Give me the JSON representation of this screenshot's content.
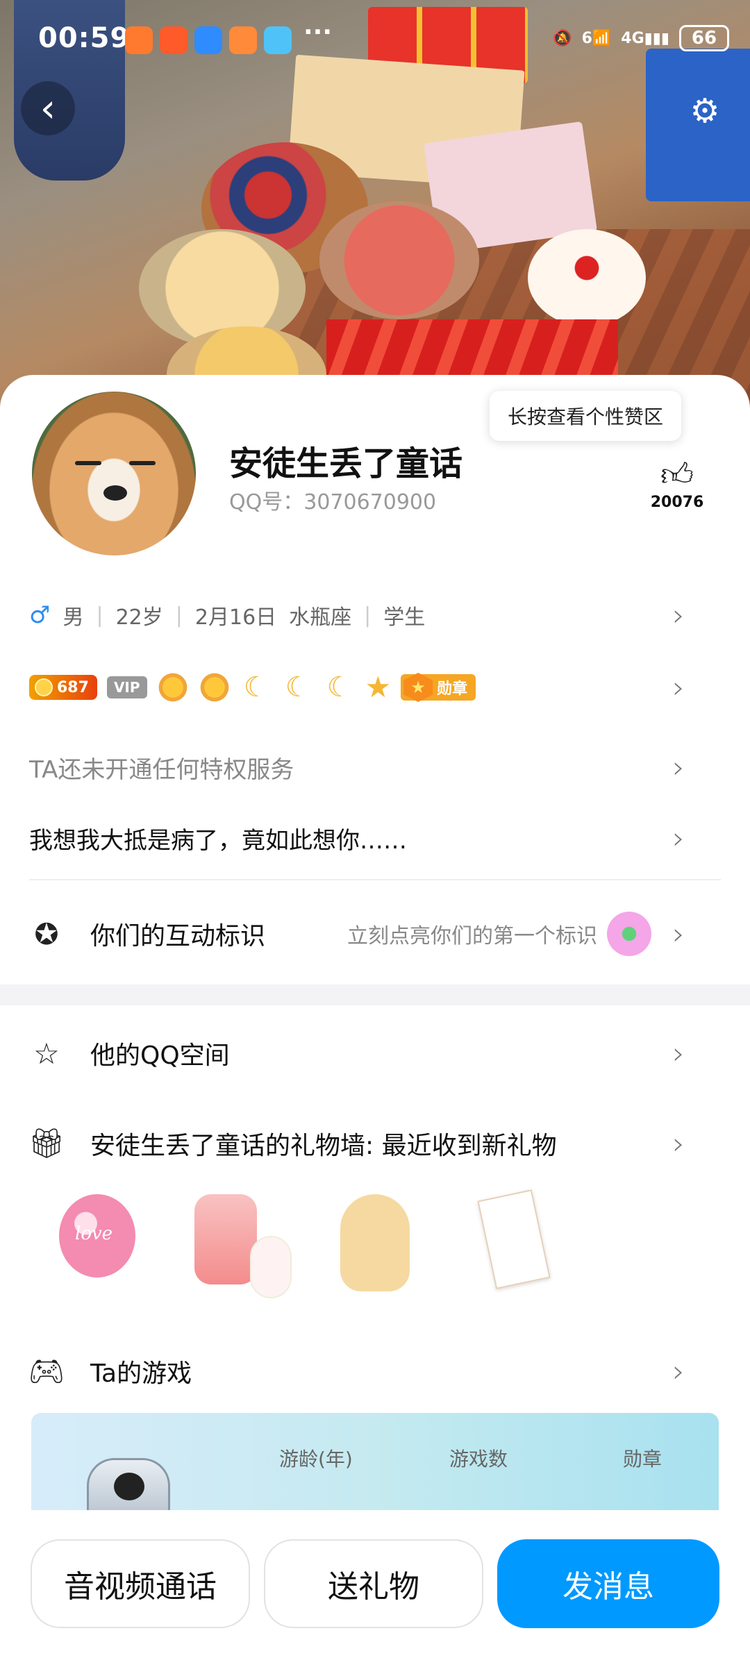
{
  "status_bar": {
    "time": "00:59",
    "more": "···",
    "network": "4G",
    "signal_prefix": "6",
    "battery": "66"
  },
  "profile": {
    "nickname": "安徒生丢了童话",
    "qq_number": "QQ号：3070670900",
    "like_tooltip": "长按查看个性赞区",
    "like_count": "20076"
  },
  "info": {
    "gender": "男",
    "age": "22岁",
    "birthday": "2月16日",
    "zodiac": "水瓶座",
    "occupation": "学生"
  },
  "badges": {
    "level": "687",
    "vip": "VIP",
    "medal_label": "勋章"
  },
  "privilege_text": "TA还未开通任何特权服务",
  "signature": "我想我大抵是病了，竟如此想你……",
  "interaction": {
    "label": "你们的互动标识",
    "hint": "立刻点亮你们的第一个标识"
  },
  "qzone_label": "他的QQ空间",
  "gift_wall_label": "安徒生丢了童话的礼物墙: 最近收到新礼物",
  "gift_balloon_text": "love",
  "game": {
    "label": "Ta的游戏",
    "stats": [
      "游龄(年)",
      "游戏数",
      "勋章"
    ]
  },
  "actions": {
    "call": "音视频通话",
    "gift": "送礼物",
    "message": "发消息"
  },
  "colors": {
    "primary": "#0099ff",
    "male": "#2d8df0",
    "level_badge": "#e8410d"
  }
}
